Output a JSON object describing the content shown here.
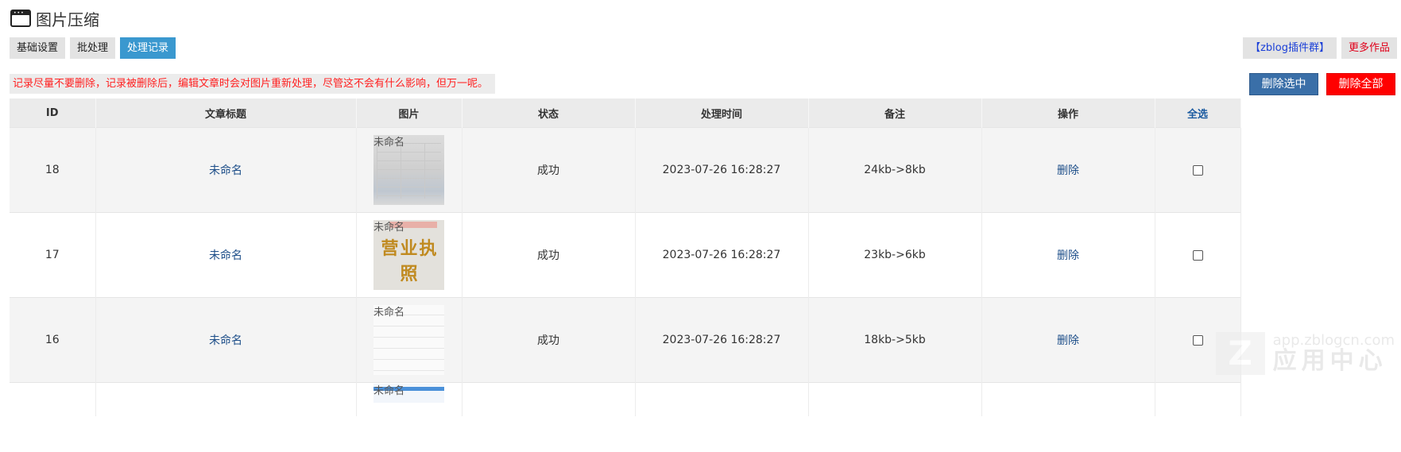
{
  "header": {
    "title": "图片压缩",
    "icon": "app-window-icon"
  },
  "tabs": [
    {
      "label": "基础设置",
      "active": false
    },
    {
      "label": "批处理",
      "active": false
    },
    {
      "label": "处理记录",
      "active": true
    }
  ],
  "links": {
    "qq_group": "【zblog插件群】",
    "more_works": "更多作品"
  },
  "notice": "记录尽量不要删除，记录被删除后，编辑文章时会对图片重新处理，尽管这不会有什么影响，但万一呢。",
  "actions": {
    "delete_selected": "删除选中",
    "delete_all": "删除全部"
  },
  "table": {
    "headers": {
      "id": "ID",
      "title": "文章标题",
      "image": "图片",
      "status": "状态",
      "time": "处理时间",
      "note": "备注",
      "op": "操作",
      "select": "全选"
    },
    "rows": [
      {
        "id": "18",
        "title": "未命名",
        "image_label": "未命名",
        "status": "成功",
        "time": "2023-07-26 16:28:27",
        "note": "24kb->8kb",
        "op": "删除"
      },
      {
        "id": "17",
        "title": "未命名",
        "image_label": "未命名",
        "image_text": "营业执照",
        "status": "成功",
        "time": "2023-07-26 16:28:27",
        "note": "23kb->6kb",
        "op": "删除"
      },
      {
        "id": "16",
        "title": "未命名",
        "image_label": "未命名",
        "status": "成功",
        "time": "2023-07-26 16:28:27",
        "note": "18kb->5kb",
        "op": "删除"
      }
    ],
    "partial_row": {
      "image_label": "未命名"
    }
  },
  "watermark": {
    "url": "app.zblogcn.com",
    "text": "应用中心",
    "logo": "Z"
  },
  "colors": {
    "active_tab": "#3a98cf",
    "delete_selected": "#3a6fa8",
    "delete_all": "#ff0000",
    "notice_text": "#ff2020",
    "link": "#1d4e89"
  }
}
